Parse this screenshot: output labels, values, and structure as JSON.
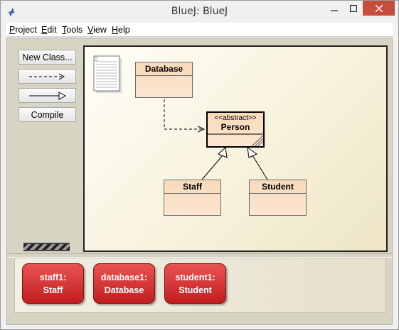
{
  "window": {
    "title": "BlueJ:  BlueJ",
    "accent": "#c74c3c"
  },
  "menu": {
    "items": [
      {
        "first": "P",
        "rest": "roject"
      },
      {
        "first": "E",
        "rest": "dit"
      },
      {
        "first": "T",
        "rest": "ools"
      },
      {
        "first": "V",
        "rest": "iew"
      },
      {
        "first": "H",
        "rest": "elp"
      }
    ]
  },
  "toolbar": {
    "new_class_label": "New Class...",
    "dependency_icon": "dashed-arrow-icon",
    "inheritance_icon": "hollow-arrow-icon",
    "compile_label": "Compile"
  },
  "diagram": {
    "readme_icon": "document-icon",
    "classes": {
      "database": {
        "name": "Database"
      },
      "person": {
        "name": "Person",
        "stereotype": "<<abstract>>"
      },
      "staff": {
        "name": "Staff"
      },
      "student": {
        "name": "Student"
      }
    },
    "class_color": "#f8dab9"
  },
  "bench": {
    "object_color": "#d63133",
    "objects": [
      {
        "name": "staff1:",
        "type": "Staff"
      },
      {
        "name": "database1:",
        "type": "Database"
      },
      {
        "name": "student1:",
        "type": "Student"
      }
    ]
  }
}
